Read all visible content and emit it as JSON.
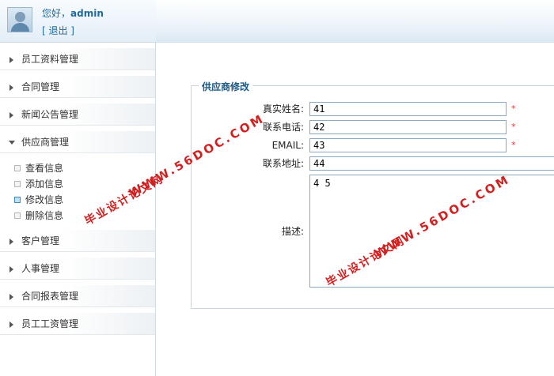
{
  "user": {
    "greeting_prefix": "您好，",
    "username": "admin",
    "logout_label": "[ 退出 ]"
  },
  "sidebar": {
    "items": [
      {
        "label": "员工资料管理",
        "open": false
      },
      {
        "label": "合同管理",
        "open": false
      },
      {
        "label": "新闻公告管理",
        "open": false
      },
      {
        "label": "供应商管理",
        "open": true
      },
      {
        "label": "客户管理",
        "open": false
      },
      {
        "label": "人事管理",
        "open": false
      },
      {
        "label": "合同报表管理",
        "open": false
      },
      {
        "label": "员工工资管理",
        "open": false
      }
    ],
    "sub_items": [
      {
        "label": "查看信息",
        "active": false
      },
      {
        "label": "添加信息",
        "active": false
      },
      {
        "label": "修改信息",
        "active": true
      },
      {
        "label": "删除信息",
        "active": false
      }
    ]
  },
  "form": {
    "legend": "供应商修改",
    "fields": [
      {
        "label": "真实姓名:",
        "value": "41",
        "required": true
      },
      {
        "label": "联系电话:",
        "value": "42",
        "required": true
      },
      {
        "label": "EMAIL:",
        "value": "43",
        "required": true
      },
      {
        "label": "联系地址:",
        "value": "44",
        "required": false
      }
    ],
    "description": {
      "label": "描述:",
      "value": "4 5"
    },
    "required_mark": "*"
  },
  "watermark": {
    "line1": "毕业设计论文网",
    "line2": "WWW.56DOC.COM"
  },
  "colors": {
    "accent": "#1f6a9b",
    "legend": "#1c5a86",
    "required": "#e23b3b",
    "watermark": "#d21f1f"
  }
}
